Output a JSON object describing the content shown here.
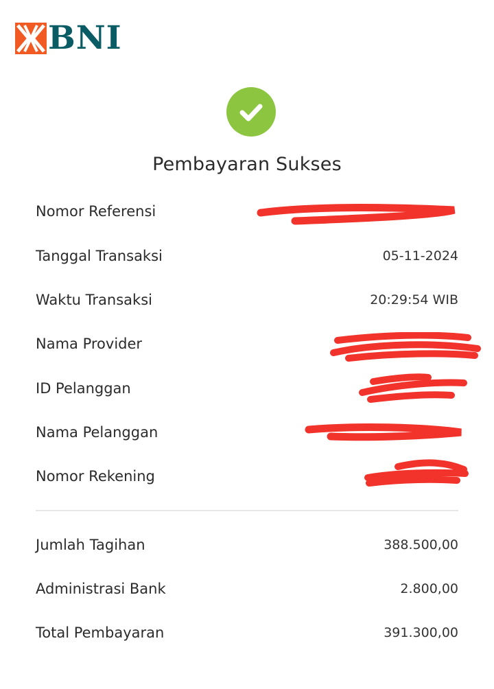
{
  "brand": {
    "name": "BNI",
    "mark_color": "#f15a22",
    "text_color": "#0a5c64"
  },
  "status": {
    "icon": "checkmark-icon",
    "icon_color": "#8cc540",
    "title": "Pembayaran Sukses"
  },
  "details": {
    "nomor_referensi": {
      "label": "Nomor Referensi",
      "value": ""
    },
    "tanggal_transaksi": {
      "label": "Tanggal Transaksi",
      "value": "05-11-2024"
    },
    "waktu_transaksi": {
      "label": "Waktu Transaksi",
      "value": "20:29:54 WIB"
    },
    "nama_provider": {
      "label": "Nama Provider",
      "value": ""
    },
    "id_pelanggan": {
      "label": "ID Pelanggan",
      "value": ""
    },
    "nama_pelanggan": {
      "label": "Nama Pelanggan",
      "value": ""
    },
    "nomor_rekening": {
      "label": "Nomor Rekening",
      "value": ""
    }
  },
  "summary": {
    "jumlah_tagihan": {
      "label": "Jumlah Tagihan",
      "value": "388.500,00"
    },
    "administrasi_bank": {
      "label": "Administrasi Bank",
      "value": "2.800,00"
    },
    "total_pembayaran": {
      "label": "Total Pembayaran",
      "value": "391.300,00"
    }
  },
  "redaction_color": "#f2332b"
}
